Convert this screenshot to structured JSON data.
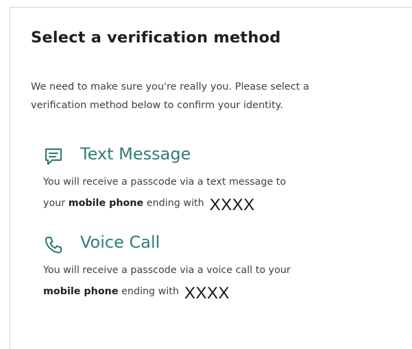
{
  "page": {
    "title": "Select a verification method",
    "intro_line1": "We need to make sure you're really you. Please select a",
    "intro_line2": "verification method below to confirm your identity."
  },
  "options": [
    {
      "icon": "chat-bubble-icon",
      "title": "Text Message",
      "desc_line1": "You will receive a passcode via a text message to",
      "desc_prefix": "your ",
      "desc_bold": "mobile phone",
      "desc_suffix": " ending with",
      "masked_number": "XXXX"
    },
    {
      "icon": "phone-icon",
      "title": "Voice Call",
      "desc_line1": "You will receive a passcode via a voice call to your",
      "desc_bold": "mobile phone",
      "desc_suffix": " ending with",
      "masked_number": "XXXX"
    }
  ],
  "colors": {
    "accent": "#2e7d77",
    "text": "#3f3f3f",
    "heading": "#1f1f1f"
  }
}
